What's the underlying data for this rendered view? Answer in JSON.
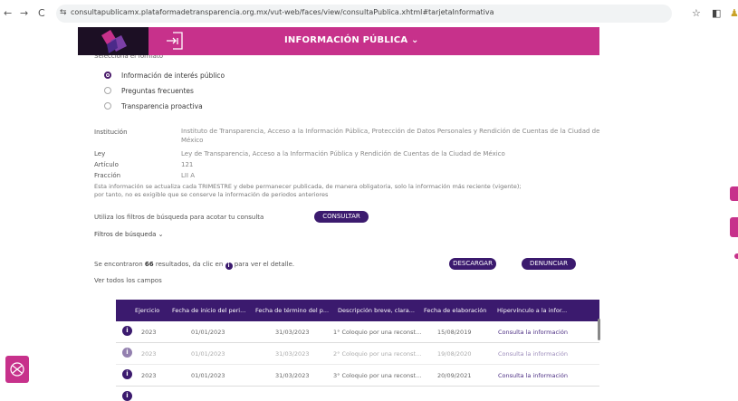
{
  "browser": {
    "url": "consultapublicamx.plataformadetransparencia.org.mx/vut-web/faces/view/consultaPublica.xhtml#tarjetaInformativa",
    "back_icon": "←",
    "forward_icon": "→",
    "reload_icon": "C",
    "site_info_icon": "⇆",
    "star_icon": "☆",
    "sidebar_icon": "◧",
    "profile_icon": "♟"
  },
  "header": {
    "title": "INFORMACIÓN PÚBLICA ⌄",
    "accent": "#c7318b",
    "dark": "#3b1a6e"
  },
  "format": {
    "cut_label": "Selecciona el formato",
    "options": [
      {
        "label": "Información de interés público",
        "selected": true
      },
      {
        "label": "Preguntas frecuentes",
        "selected": false
      },
      {
        "label": "Transparencia proactiva",
        "selected": false
      }
    ]
  },
  "details": {
    "institucion_label": "Institución",
    "institucion_line1": "Instituto de Transparencia, Acceso a la Información Pública, Protección de Datos Personales y Rendición de Cuentas de la Ciudad de",
    "institucion_line2": "México",
    "ley_label": "Ley",
    "ley_value": "Ley de Transparencia, Acceso a la Información Pública y Rendición de Cuentas de la Ciudad de México",
    "articulo_label": "Artículo",
    "articulo_value": "121",
    "fraccion_label": "Fracción",
    "fraccion_value": "LII A",
    "note_line1": "Esta información se actualiza cada TRIMESTRE y debe permanecer publicada, de manera obligatoria, solo la información más reciente (vigente);",
    "note_line2": "por tanto, no es exigible que se conserve la información de periodos anteriores"
  },
  "filters": {
    "hint": "Utiliza los filtros de búsqueda para acotar tu consulta",
    "consult_label": "CONSULTAR",
    "toggle_label": "Filtros de búsqueda ⌄"
  },
  "results": {
    "prefix": "Se encontraron ",
    "count": "66",
    "suffix": " resultados, da clic en",
    "suffix2": "para ver el detalle.",
    "download_label": "DESCARGAR",
    "report_label": "DENUNCIAR",
    "all_fields": "Ver todos los campos"
  },
  "table": {
    "columns": [
      "Ejercicio",
      "Fecha de inicio del peri...",
      "Fecha de término del p...",
      "Descripción breve, clara...",
      "Fecha de elaboración",
      "Hipervínculo a la infor..."
    ],
    "rows": [
      {
        "ejercicio": "2023",
        "inicio": "01/01/2023",
        "termino": "31/03/2023",
        "descripcion": "1° Coloquio por una reconst...",
        "elaboracion": "15/08/2019",
        "hipervinculo": "Consulta la información"
      },
      {
        "ejercicio": "2023",
        "inicio": "01/01/2023",
        "termino": "31/03/2023",
        "descripcion": "2° Coloquio por una reconst...",
        "elaboracion": "19/08/2020",
        "hipervinculo": "Consulta la información"
      },
      {
        "ejercicio": "2023",
        "inicio": "01/01/2023",
        "termino": "31/03/2023",
        "descripcion": "3° Coloquio por una reconst...",
        "elaboracion": "20/09/2021",
        "hipervinculo": "Consulta la información"
      }
    ]
  }
}
